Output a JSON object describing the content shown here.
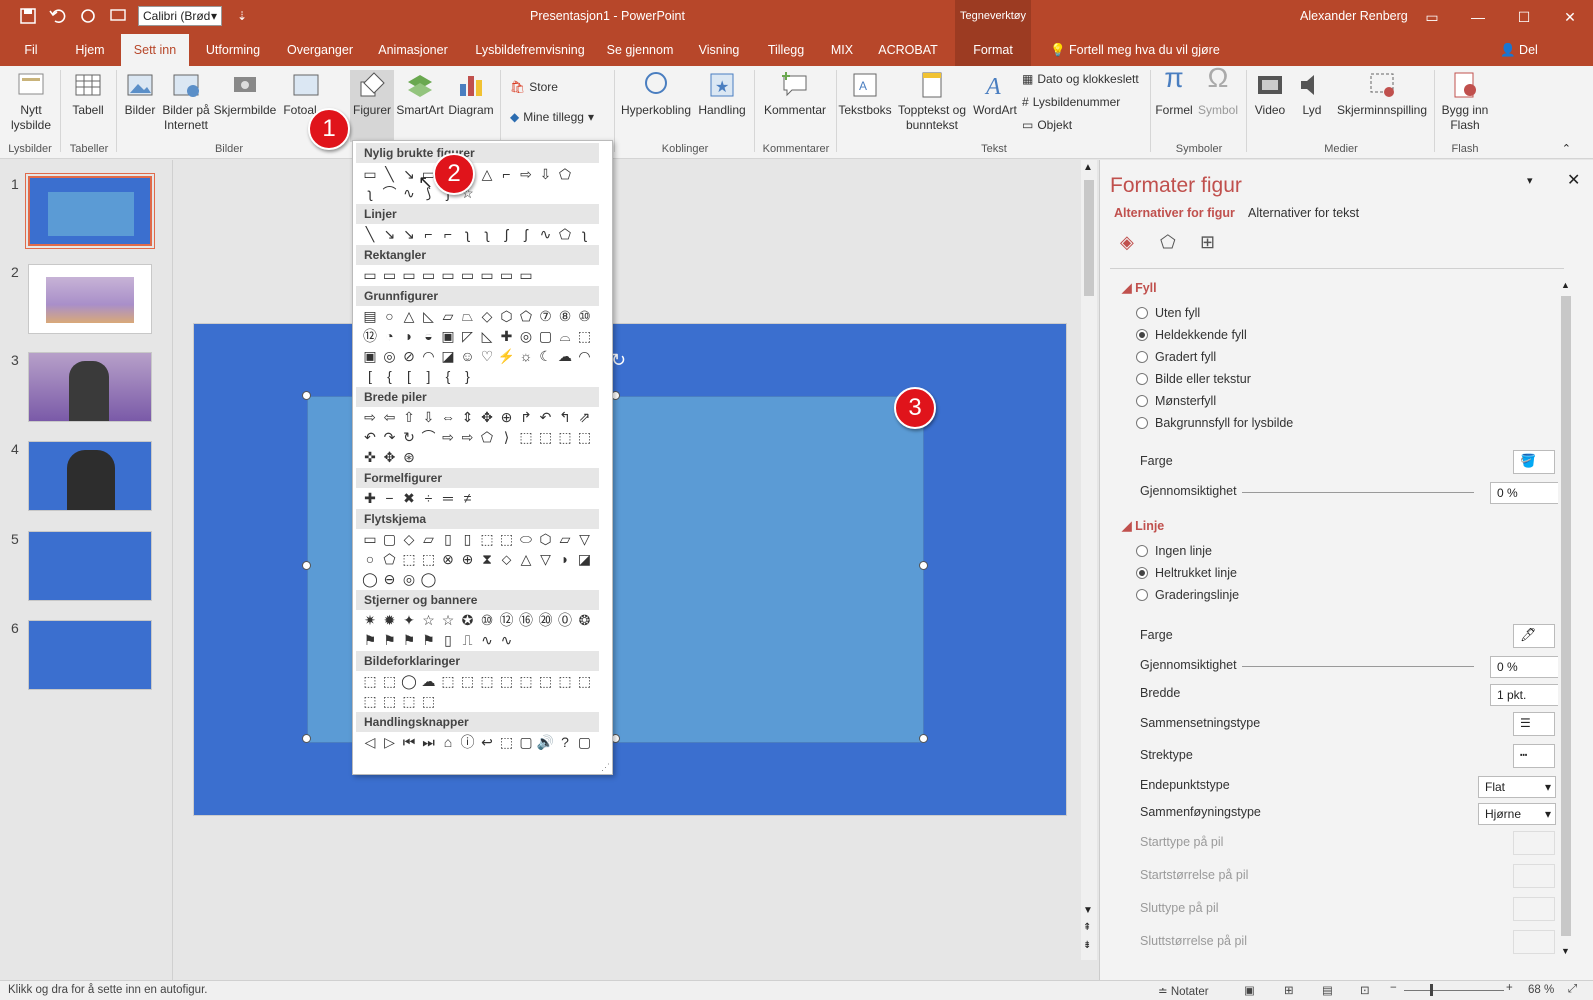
{
  "titlebar": {
    "title": "Presentasjon1  -  PowerPoint",
    "context_group": "Tegneverktøy",
    "user": "Alexander Renberg",
    "font_box": "Calibri (Brød"
  },
  "tabs": [
    "Fil",
    "Hjem",
    "Sett inn",
    "Utforming",
    "Overganger",
    "Animasjoner",
    "Lysbildefremvisning",
    "Se gjennom",
    "Visning",
    "Tillegg",
    "MIX",
    "ACROBAT",
    "Format"
  ],
  "tellme": "Fortell meg hva du vil gjøre",
  "share": "Del",
  "ribbon": {
    "nytt": "Nytt lysbilde",
    "tabell": "Tabell",
    "bilder": "Bilder",
    "bilder_paa": "Bilder på Internett",
    "skjermbilde": "Skjermbilde",
    "fotoalbum": "Fotoal…",
    "figurer": "Figurer",
    "smartart": "SmartArt",
    "diagram": "Diagram",
    "store": "Store",
    "mine": "Mine tillegg",
    "hyperkobling": "Hyperkobling",
    "handling": "Handling",
    "kommentar": "Kommentar",
    "tekstboks": "Tekstboks",
    "topptekst": "Topptekst og bunntekst",
    "wordart": "WordArt",
    "dato": "Dato og klokkeslett",
    "lysnr": "Lysbildenummer",
    "objekt": "Objekt",
    "formel": "Formel",
    "symbol": "Symbol",
    "video": "Video",
    "lyd": "Lyd",
    "skjerminn": "Skjerminnspilling",
    "flash": "Bygg inn Flash",
    "groups": [
      "Lysbilder",
      "Tabeller",
      "Bilder",
      "Koblinger",
      "Kommentarer",
      "Tekst",
      "Symboler",
      "Medier",
      "Flash"
    ]
  },
  "shapes": {
    "headers": [
      "Nylig brukte figurer",
      "Linjer",
      "Rektangler",
      "Grunnfigurer",
      "Brede piler",
      "Formelfigurer",
      "Flytskjema",
      "Stjerner og bannere",
      "Bildeforklaringer",
      "Handlingsknapper"
    ]
  },
  "slides": [
    "1",
    "2",
    "3",
    "4",
    "5",
    "6"
  ],
  "badges": [
    "1",
    "2",
    "3"
  ],
  "pane": {
    "title": "Formater figur",
    "tab1": "Alternativer for figur",
    "tab2": "Alternativer for tekst",
    "fill": "Fyll",
    "fill_opts": [
      "Uten fyll",
      "Heldekkende fyll",
      "Gradert fyll",
      "Bilde eller tekstur",
      "Mønsterfyll",
      "Bakgrunnsfyll for lysbilde"
    ],
    "farge": "Farge",
    "gjennom": "Gjennomsiktighet",
    "pct": "0 %",
    "line": "Linje",
    "line_opts": [
      "Ingen linje",
      "Heltrukket linje",
      "Graderingslinje"
    ],
    "bredde": "Bredde",
    "bredde_val": "1 pkt.",
    "sammen": "Sammensetningstype",
    "strek": "Strektype",
    "endep": "Endepunktstype",
    "endep_val": "Flat",
    "sammenf": "Sammenføyningstype",
    "sammenf_val": "Hjørne",
    "starttype": "Starttype på pil",
    "startstr": "Startstørrelse på pil",
    "sluttype": "Sluttype på pil",
    "sluttstr": "Sluttstørrelse på pil"
  },
  "status": {
    "hint": "Klikk og dra for å sette inn en autofigur.",
    "notater": "Notater",
    "zoom": "68 %"
  }
}
